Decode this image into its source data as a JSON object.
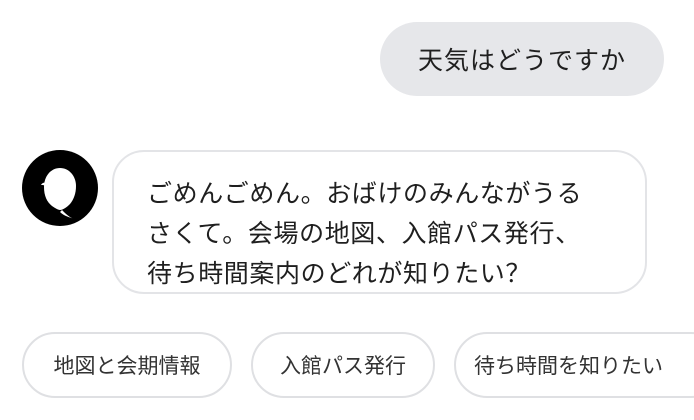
{
  "user_message": "天気はどうですか",
  "bot": {
    "avatar_icon": "ghost-icon",
    "lines": [
      "ごめんごめん。おばけのみんながうる",
      "さくて。会場の地図、入館パス発行、",
      "待ち時間案内のどれが知りたい？"
    ]
  },
  "quick_replies": [
    "地図と会期情報",
    "入館パス発行",
    "待ち時間を知りたい"
  ]
}
